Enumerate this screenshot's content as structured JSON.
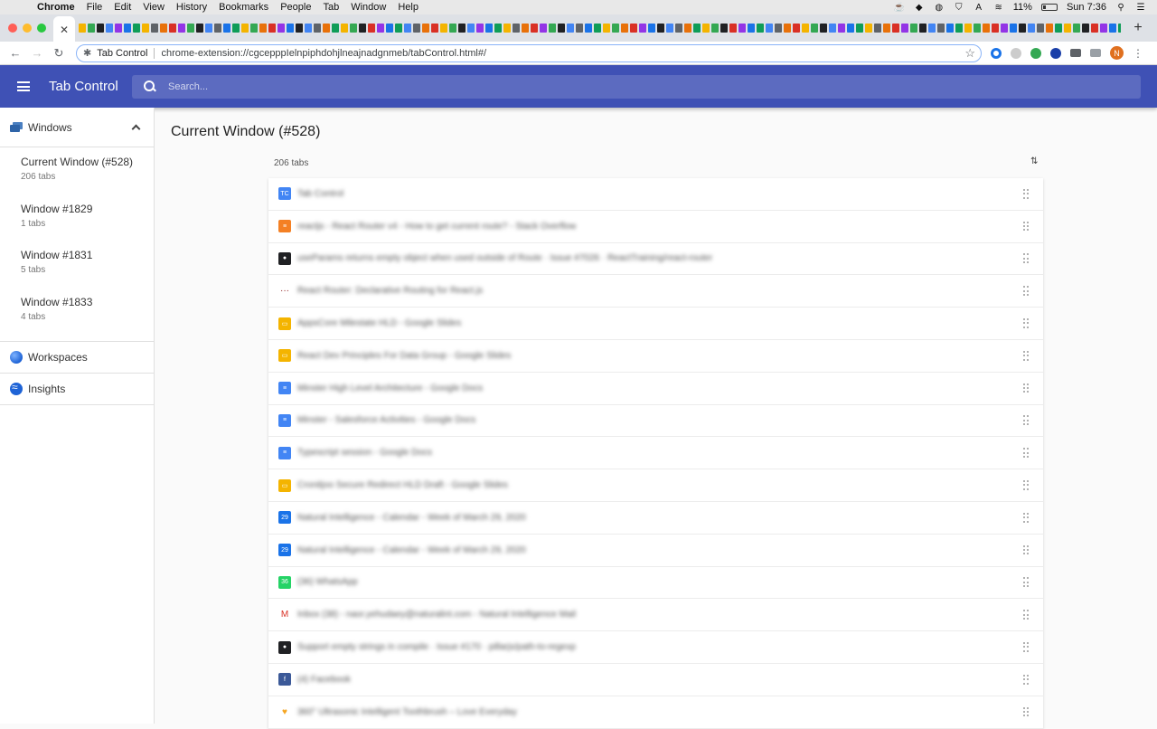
{
  "menubar": {
    "app": "Chrome",
    "menus": [
      "File",
      "Edit",
      "View",
      "History",
      "Bookmarks",
      "People",
      "Tab",
      "Window",
      "Help"
    ],
    "battery": "11%",
    "clock": "Sun 7:36",
    "tray_A": "A"
  },
  "browser": {
    "active_tab_close": "✕",
    "new_tab": "+",
    "site_name": "Tab Control",
    "url": "chrome-extension://cgcepppIelnpiphdohjlneajnadgnmeb/tabControl.html#/",
    "avatar_letter": "N",
    "pinned_colors": [
      "#f4b400",
      "#4285f4",
      "#d93025",
      "#0f9d58",
      "#202124",
      "#e8710a",
      "#1a73e8",
      "#34a853",
      "#5f6368",
      "#9334e6"
    ]
  },
  "appbar": {
    "title": "Tab Control",
    "search_placeholder": "Search..."
  },
  "sidebar": {
    "windows_label": "Windows",
    "windows": [
      {
        "name": "Current Window (#528)",
        "count": "206 tabs"
      },
      {
        "name": "Window #1829",
        "count": "1 tabs"
      },
      {
        "name": "Window #1831",
        "count": "5 tabs"
      },
      {
        "name": "Window #1833",
        "count": "4 tabs"
      }
    ],
    "workspaces_label": "Workspaces",
    "insights_label": "Insights"
  },
  "main": {
    "title": "Current Window (#528)",
    "tab_count": "206 tabs",
    "tabs": [
      {
        "title": "Tab Control",
        "icon": "tab-control-icon",
        "color": "#4285f4",
        "glyph": "TC"
      },
      {
        "title": "reactjs - React Router v4 - How to get current route? - Stack Overflow",
        "icon": "stackoverflow-icon",
        "color": "#f48024",
        "glyph": "≡"
      },
      {
        "title": "useParams returns empty object when used outside of Route · Issue #7026 · ReactTraining/react-router",
        "icon": "github-icon",
        "color": "#202124",
        "glyph": "●"
      },
      {
        "title": "React Router: Declarative Routing for React.js",
        "icon": "react-router-icon",
        "color": "#ffffff",
        "glyph": "···"
      },
      {
        "title": "AppsCore Milestate HLD - Google Slides",
        "icon": "google-slides-icon",
        "color": "#f4b400",
        "glyph": "▭"
      },
      {
        "title": "React Dev Principles For Data Group - Google Slides",
        "icon": "google-slides-icon",
        "color": "#f4b400",
        "glyph": "▭"
      },
      {
        "title": "Minster High Level Architecture - Google Docs",
        "icon": "google-docs-icon",
        "color": "#4285f4",
        "glyph": "≡"
      },
      {
        "title": "Minster - Salesforce Activities - Google Docs",
        "icon": "google-docs-icon",
        "color": "#4285f4",
        "glyph": "≡"
      },
      {
        "title": "Typescript session - Google Docs",
        "icon": "google-docs-icon",
        "color": "#4285f4",
        "glyph": "≡"
      },
      {
        "title": "Cronitjoo Secure Redirect HLD Draft - Google Slides",
        "icon": "google-slides-icon",
        "color": "#f4b400",
        "glyph": "▭"
      },
      {
        "title": "Natural Intelligence - Calendar - Week of March 29, 2020",
        "icon": "google-calendar-icon",
        "color": "#1a73e8",
        "glyph": "29"
      },
      {
        "title": "Natural Intelligence - Calendar - Week of March 29, 2020",
        "icon": "google-calendar-icon",
        "color": "#1a73e8",
        "glyph": "29"
      },
      {
        "title": "(36) WhatsApp",
        "icon": "whatsapp-icon",
        "color": "#25d366",
        "glyph": "36"
      },
      {
        "title": "Inbox (38) - naor.yehudaey@naturalint.com - Natural Intelligence Mail",
        "icon": "gmail-icon",
        "color": "#ffffff",
        "glyph": "M"
      },
      {
        "title": "Support empty strings in compile · Issue #170 · pillarjs/path-to-regexp",
        "icon": "github-icon",
        "color": "#202124",
        "glyph": "●"
      },
      {
        "title": "(4) Facebook",
        "icon": "facebook-icon",
        "color": "#3b5998",
        "glyph": "f"
      },
      {
        "title": "360° Ultrasonic Intelligent Toothbrush – Love Everyday",
        "icon": "heart-icon",
        "color": "#ffffff",
        "glyph": "♥"
      }
    ]
  }
}
